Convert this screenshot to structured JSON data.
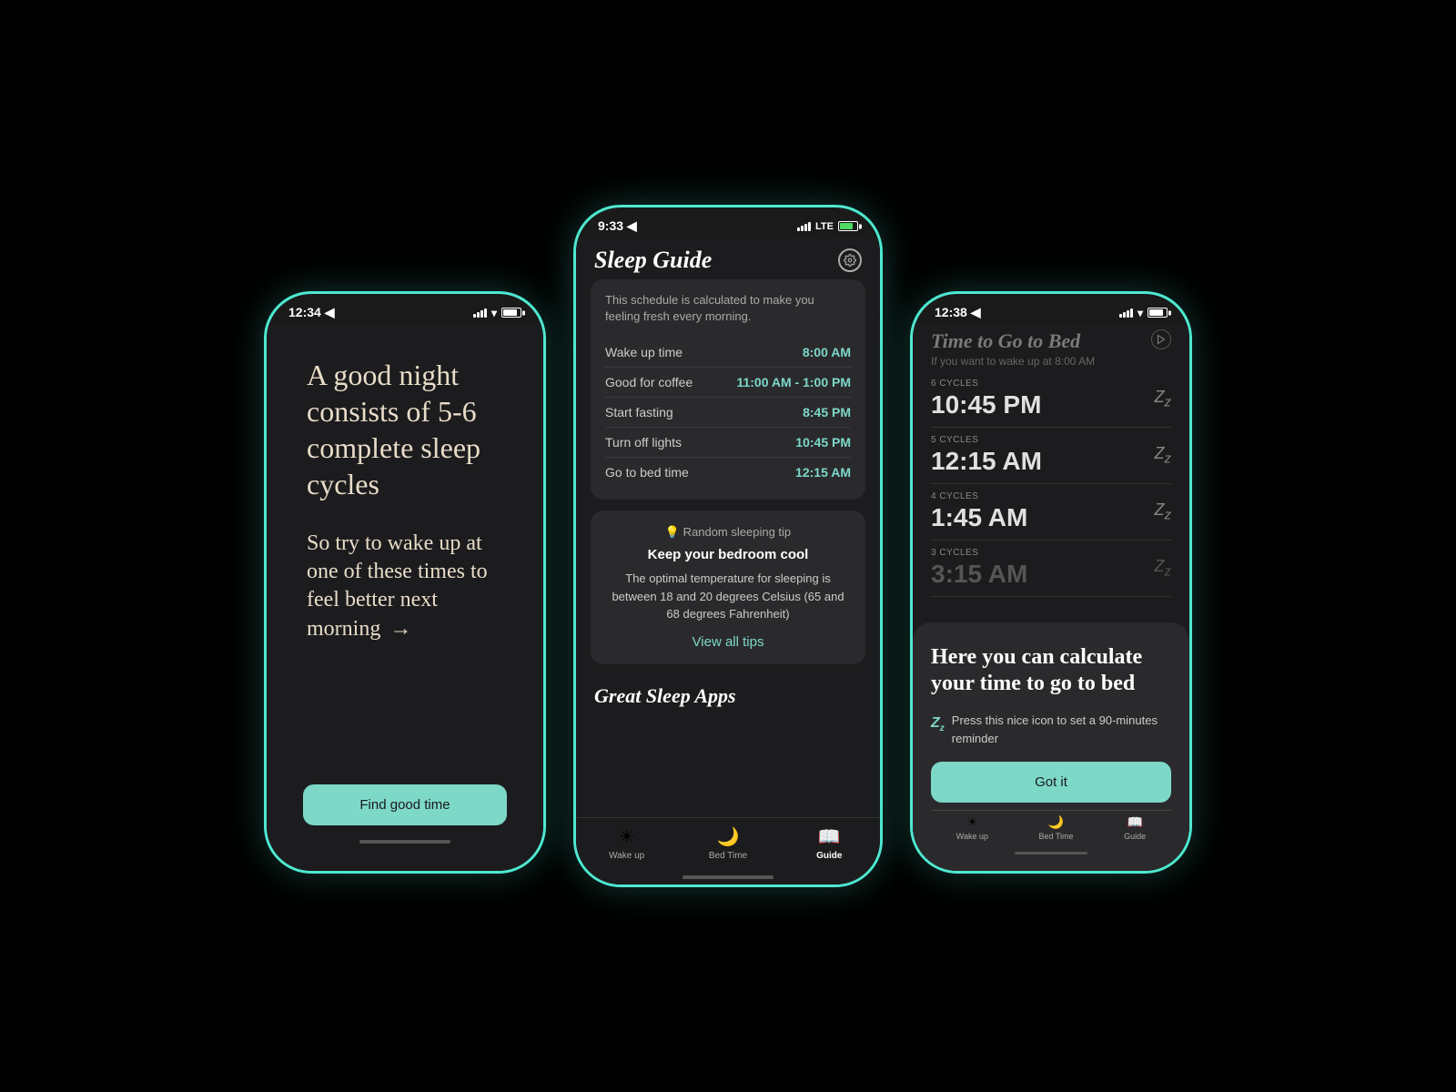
{
  "background": "#000000",
  "accent_color": "#4ee8d0",
  "button_color": "#7dd8c8",
  "left_phone": {
    "status_time": "12:34 ◀",
    "headline1": "A good night consists of 5-6 complete sleep cycles",
    "headline2": "So try to wake up at one of these times to feel better next morning",
    "arrow": "→",
    "cta_label": "Find good time"
  },
  "center_phone": {
    "status_time": "9:33 ◀",
    "title": "Sleep Guide",
    "gear_label": "⚙",
    "schedule_desc": "This schedule is calculated to make you feeling fresh every morning.",
    "schedule_rows": [
      {
        "label": "Wake up time",
        "value": "8:00 AM"
      },
      {
        "label": "Good for coffee",
        "value": "11:00 AM - 1:00 PM"
      },
      {
        "label": "Start fasting",
        "value": "8:45 PM"
      },
      {
        "label": "Turn off lights",
        "value": "10:45 PM"
      },
      {
        "label": "Go to bed time",
        "value": "12:15 AM"
      }
    ],
    "tip_section_label": "💡 Random sleeping tip",
    "tip_title": "Keep your bedroom cool",
    "tip_body": "The optimal temperature for sleeping is between 18 and 20 degrees Celsius (65 and 68 degrees Fahrenheit)",
    "view_all_tips": "View all tips",
    "great_apps_title": "Great Sleep Apps",
    "tabs": [
      {
        "icon": "☀",
        "label": "Wake up",
        "active": false
      },
      {
        "icon": "🌙",
        "label": "Bed Time",
        "active": false
      },
      {
        "icon": "📖",
        "label": "Guide",
        "active": true
      }
    ]
  },
  "right_phone": {
    "status_time": "12:38 ◀",
    "title": "Time to Go to Bed",
    "subtitle": "If you want to wake up at 8:00 AM",
    "cycles": [
      {
        "cycles_label": "6 CYCLES",
        "time": "10:45 PM",
        "faded": false
      },
      {
        "cycles_label": "5 CYCLES",
        "time": "12:15 AM",
        "faded": false
      },
      {
        "cycles_label": "4 CYCLES",
        "time": "1:45 AM",
        "faded": false
      },
      {
        "cycles_label": "3 CYCLES",
        "time": "3:15 AM",
        "faded": true
      }
    ],
    "overlay_title": "Here you can calculate your time to go to bed",
    "overlay_desc_icon": "ZZ",
    "overlay_desc": "Press this nice icon to set a 90-minutes reminder",
    "cta_label": "Got it",
    "tab_wake_up": "Wake up",
    "tab_bed_time": "Bed Time",
    "tab_guide": "Guide"
  }
}
